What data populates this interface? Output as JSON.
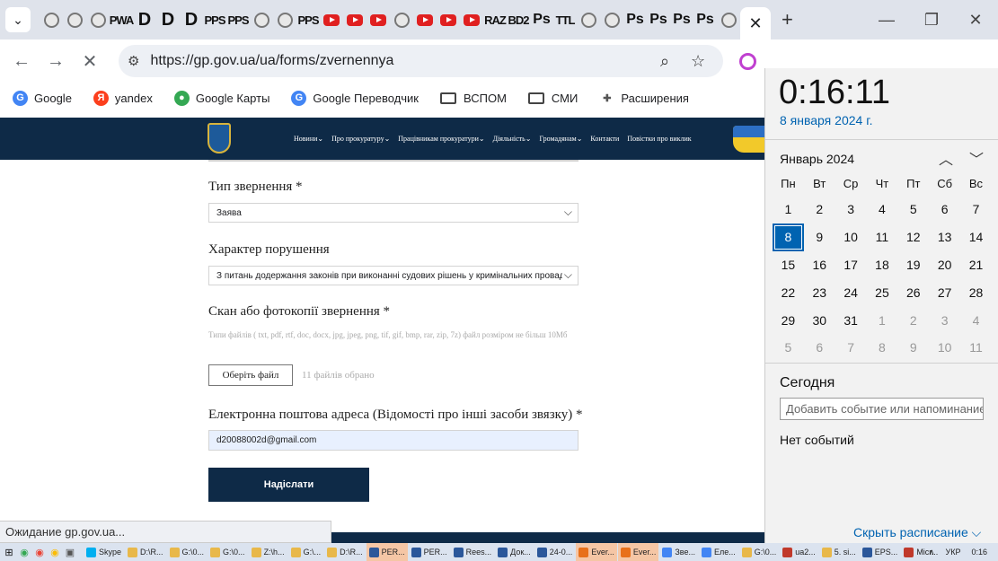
{
  "tabstrip": {
    "favicons": [
      "globe",
      "globe",
      "globe",
      "PWA",
      "D",
      "D",
      "D",
      "PPS",
      "PPS",
      "globe",
      "globe",
      "PPS",
      "yt",
      "yt",
      "yt",
      "globe",
      "yt",
      "yt",
      "yt",
      "RAZ",
      "BD2",
      "Ps",
      "TTL",
      "globe",
      "globe",
      "Ps",
      "Ps",
      "Ps",
      "Ps",
      "globe"
    ],
    "close_glyph": "✕",
    "new_tab_glyph": "+",
    "minimize_glyph": "—",
    "restore_glyph": "❐",
    "window_close_glyph": "✕"
  },
  "toolbar": {
    "url": "https://gp.gov.ua/ua/forms/zvernennya"
  },
  "bookmarks": [
    {
      "label": "Google",
      "icon": "G",
      "color": "#4285f4"
    },
    {
      "label": "yandex",
      "icon": "Я",
      "color": "#fc3f1d"
    },
    {
      "label": "Google Карты",
      "icon": "●",
      "color": "#34a853"
    },
    {
      "label": "Google Переводчик",
      "icon": "G",
      "color": "#4285f4"
    },
    {
      "label": "ВСПОМ",
      "icon": "folder"
    },
    {
      "label": "СМИ",
      "icon": "folder"
    },
    {
      "label": "Расширения",
      "icon": "puzzle"
    }
  ],
  "site": {
    "nav": [
      "Новини",
      "Про прокуратуру",
      "Працівникам прокуратури",
      "Діяльність",
      "Громадянам",
      "Контакти",
      "Повістки про виклик"
    ]
  },
  "form": {
    "type_label": "Тип звернення *",
    "type_value": "Заява",
    "nature_label": "Характер порушення",
    "nature_value": "З питань додержання законів при виконанні судових рішень у кримінальних провадженнях",
    "scan_label": "Скан або фотокопії звернення *",
    "scan_hint": "Типи файлів ( txt, pdf, rtf, doc, docx, jpg, jpeg, png, tif, gif, bmp, rar, zip, 7z) файл розміром не більш 10Мб",
    "file_button": "Оберіть файл",
    "file_count": "11 файлів обрано",
    "email_label": "Електронна поштова адреса (Відомості про інші засоби звязку) *",
    "email_value": "d20088002d@gmail.com",
    "submit": "Надіслати"
  },
  "status_text": "Ожидание gp.gov.ua...",
  "calendar": {
    "time": "0:16:11",
    "date": "8 января 2024 г.",
    "month": "Январь 2024",
    "weekdays": [
      "Пн",
      "Вт",
      "Ср",
      "Чт",
      "Пт",
      "Сб",
      "Вс"
    ],
    "days": [
      {
        "d": "1"
      },
      {
        "d": "2"
      },
      {
        "d": "3"
      },
      {
        "d": "4"
      },
      {
        "d": "5"
      },
      {
        "d": "6"
      },
      {
        "d": "7"
      },
      {
        "d": "8",
        "today": true
      },
      {
        "d": "9"
      },
      {
        "d": "10"
      },
      {
        "d": "11"
      },
      {
        "d": "12"
      },
      {
        "d": "13"
      },
      {
        "d": "14"
      },
      {
        "d": "15"
      },
      {
        "d": "16"
      },
      {
        "d": "17"
      },
      {
        "d": "18"
      },
      {
        "d": "19"
      },
      {
        "d": "20"
      },
      {
        "d": "21"
      },
      {
        "d": "22"
      },
      {
        "d": "23"
      },
      {
        "d": "24"
      },
      {
        "d": "25"
      },
      {
        "d": "26"
      },
      {
        "d": "27"
      },
      {
        "d": "28"
      },
      {
        "d": "29"
      },
      {
        "d": "30"
      },
      {
        "d": "31"
      },
      {
        "d": "1",
        "other": true
      },
      {
        "d": "2",
        "other": true
      },
      {
        "d": "3",
        "other": true
      },
      {
        "d": "4",
        "other": true
      },
      {
        "d": "5",
        "other": true
      },
      {
        "d": "6",
        "other": true
      },
      {
        "d": "7",
        "other": true
      },
      {
        "d": "8",
        "other": true
      },
      {
        "d": "9",
        "other": true
      },
      {
        "d": "10",
        "other": true
      },
      {
        "d": "11",
        "other": true
      }
    ],
    "today_label": "Сегодня",
    "event_placeholder": "Добавить событие или напоминание",
    "no_events": "Нет событий",
    "hide_schedule": "Скрыть расписание"
  },
  "taskbar": {
    "apps": [
      {
        "label": "Skype",
        "color": "#00aff0"
      },
      {
        "label": "D:\\R...",
        "color": "#e8b84a"
      },
      {
        "label": "G:\\0...",
        "color": "#e8b84a"
      },
      {
        "label": "G:\\0...",
        "color": "#e8b84a"
      },
      {
        "label": "Z:\\h...",
        "color": "#e8b84a"
      },
      {
        "label": "G:\\...",
        "color": "#e8b84a"
      },
      {
        "label": "D:\\R...",
        "color": "#e8b84a"
      },
      {
        "label": "PER...",
        "color": "#2b579a",
        "active": true
      },
      {
        "label": "PER...",
        "color": "#2b579a"
      },
      {
        "label": "Rees...",
        "color": "#2b579a"
      },
      {
        "label": "Док...",
        "color": "#2b579a"
      },
      {
        "label": "24-0...",
        "color": "#2b579a"
      },
      {
        "label": "Ever...",
        "color": "#e8701a",
        "active": true
      },
      {
        "label": "Ever...",
        "color": "#e8701a",
        "active": true
      },
      {
        "label": "Зве...",
        "color": "#4285f4"
      },
      {
        "label": "Еле...",
        "color": "#4285f4"
      },
      {
        "label": "G:\\0...",
        "color": "#e8b84a"
      },
      {
        "label": "ua2...",
        "color": "#c0392b"
      },
      {
        "label": "5. si...",
        "color": "#e8b84a"
      },
      {
        "label": "EPS...",
        "color": "#2b579a"
      },
      {
        "label": "Micr...",
        "color": "#c0392b"
      }
    ],
    "lang": "УКР",
    "time": "0:16"
  }
}
